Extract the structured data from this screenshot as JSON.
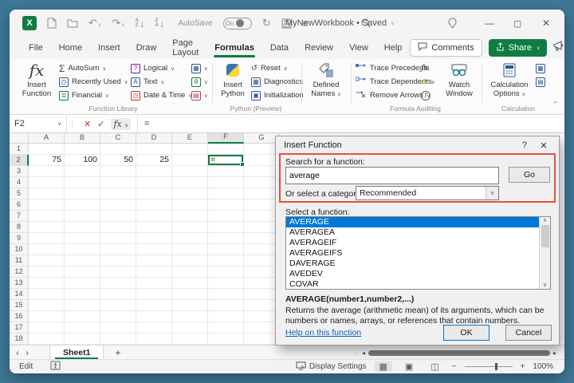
{
  "titlebar": {
    "autosave_label": "AutoSave",
    "autosave_state": "On",
    "title": "MyNewWorkbook • Saved"
  },
  "tabs": {
    "items": [
      "File",
      "Home",
      "Insert",
      "Draw",
      "Page Layout",
      "Formulas",
      "Data",
      "Review",
      "View",
      "Help"
    ],
    "active": "Formulas",
    "comments": "Comments",
    "share": "Share"
  },
  "ribbon": {
    "insert_function": {
      "line1": "Insert",
      "line2": "Function"
    },
    "function_library": {
      "label": "Function Library",
      "col1": [
        "AutoSum",
        "Recently Used",
        "Financial"
      ],
      "col2": [
        "Logical",
        "Text",
        "Date & Time"
      ]
    },
    "python": {
      "label": "Python (Preview)",
      "big1": "Insert",
      "big2": "Python",
      "items": [
        "Reset",
        "Diagnostics",
        "Initialization"
      ]
    },
    "defined_names": {
      "line1": "Defined",
      "line2": "Names"
    },
    "auditing": {
      "label": "Formula Auditing",
      "items": [
        "Trace Precedents",
        "Trace Dependents",
        "Remove Arrows"
      ],
      "watch1": "Watch",
      "watch2": "Window"
    },
    "calculation": {
      "label": "Calculation",
      "big1": "Calculation",
      "big2": "Options"
    }
  },
  "formula_bar": {
    "name_box": "F2",
    "content": "="
  },
  "grid": {
    "columns": [
      "A",
      "B",
      "C",
      "D",
      "E",
      "F",
      "G"
    ],
    "active_column": "F",
    "row_numbers": [
      "1",
      "2",
      "3",
      "4",
      "5",
      "6",
      "7",
      "8",
      "9",
      "10",
      "11",
      "12",
      "13",
      "14",
      "15",
      "16",
      "17",
      "18"
    ],
    "active_row": "2",
    "row2_values": [
      "75",
      "100",
      "50",
      "25",
      "",
      "=",
      ""
    ],
    "active_cell": "F2"
  },
  "dialog": {
    "title": "Insert Function",
    "search_label": "Search for a function:",
    "search_value": "average",
    "go": "Go",
    "category_label": "Or select a category:",
    "category_value": "Recommended",
    "select_label": "Select a function:",
    "functions": [
      "AVERAGE",
      "AVERAGEA",
      "AVERAGEIF",
      "AVERAGEIFS",
      "DAVERAGE",
      "AVEDEV",
      "COVAR"
    ],
    "selected_function": "AVERAGE",
    "signature": "AVERAGE(number1,number2,...)",
    "description": "Returns the average (arithmetic mean) of its arguments, which can be numbers or names, arrays, or references that contain numbers.",
    "help_link": "Help on this function",
    "ok": "OK",
    "cancel": "Cancel"
  },
  "sheet_bar": {
    "sheet": "Sheet1"
  },
  "status_bar": {
    "mode": "Edit",
    "display_settings": "Display Settings",
    "zoom": "100%"
  },
  "colors": {
    "accent_green": "#107c41",
    "selection_blue": "#0078d7",
    "annotation_red": "#e8503e",
    "frame": "#3e7897"
  },
  "icons": {
    "autosum": "Σ",
    "reset": "↺",
    "undo": "↶",
    "redo": "↷",
    "sync": "↻",
    "error_checking": "⚠",
    "math_trig": "θ"
  }
}
